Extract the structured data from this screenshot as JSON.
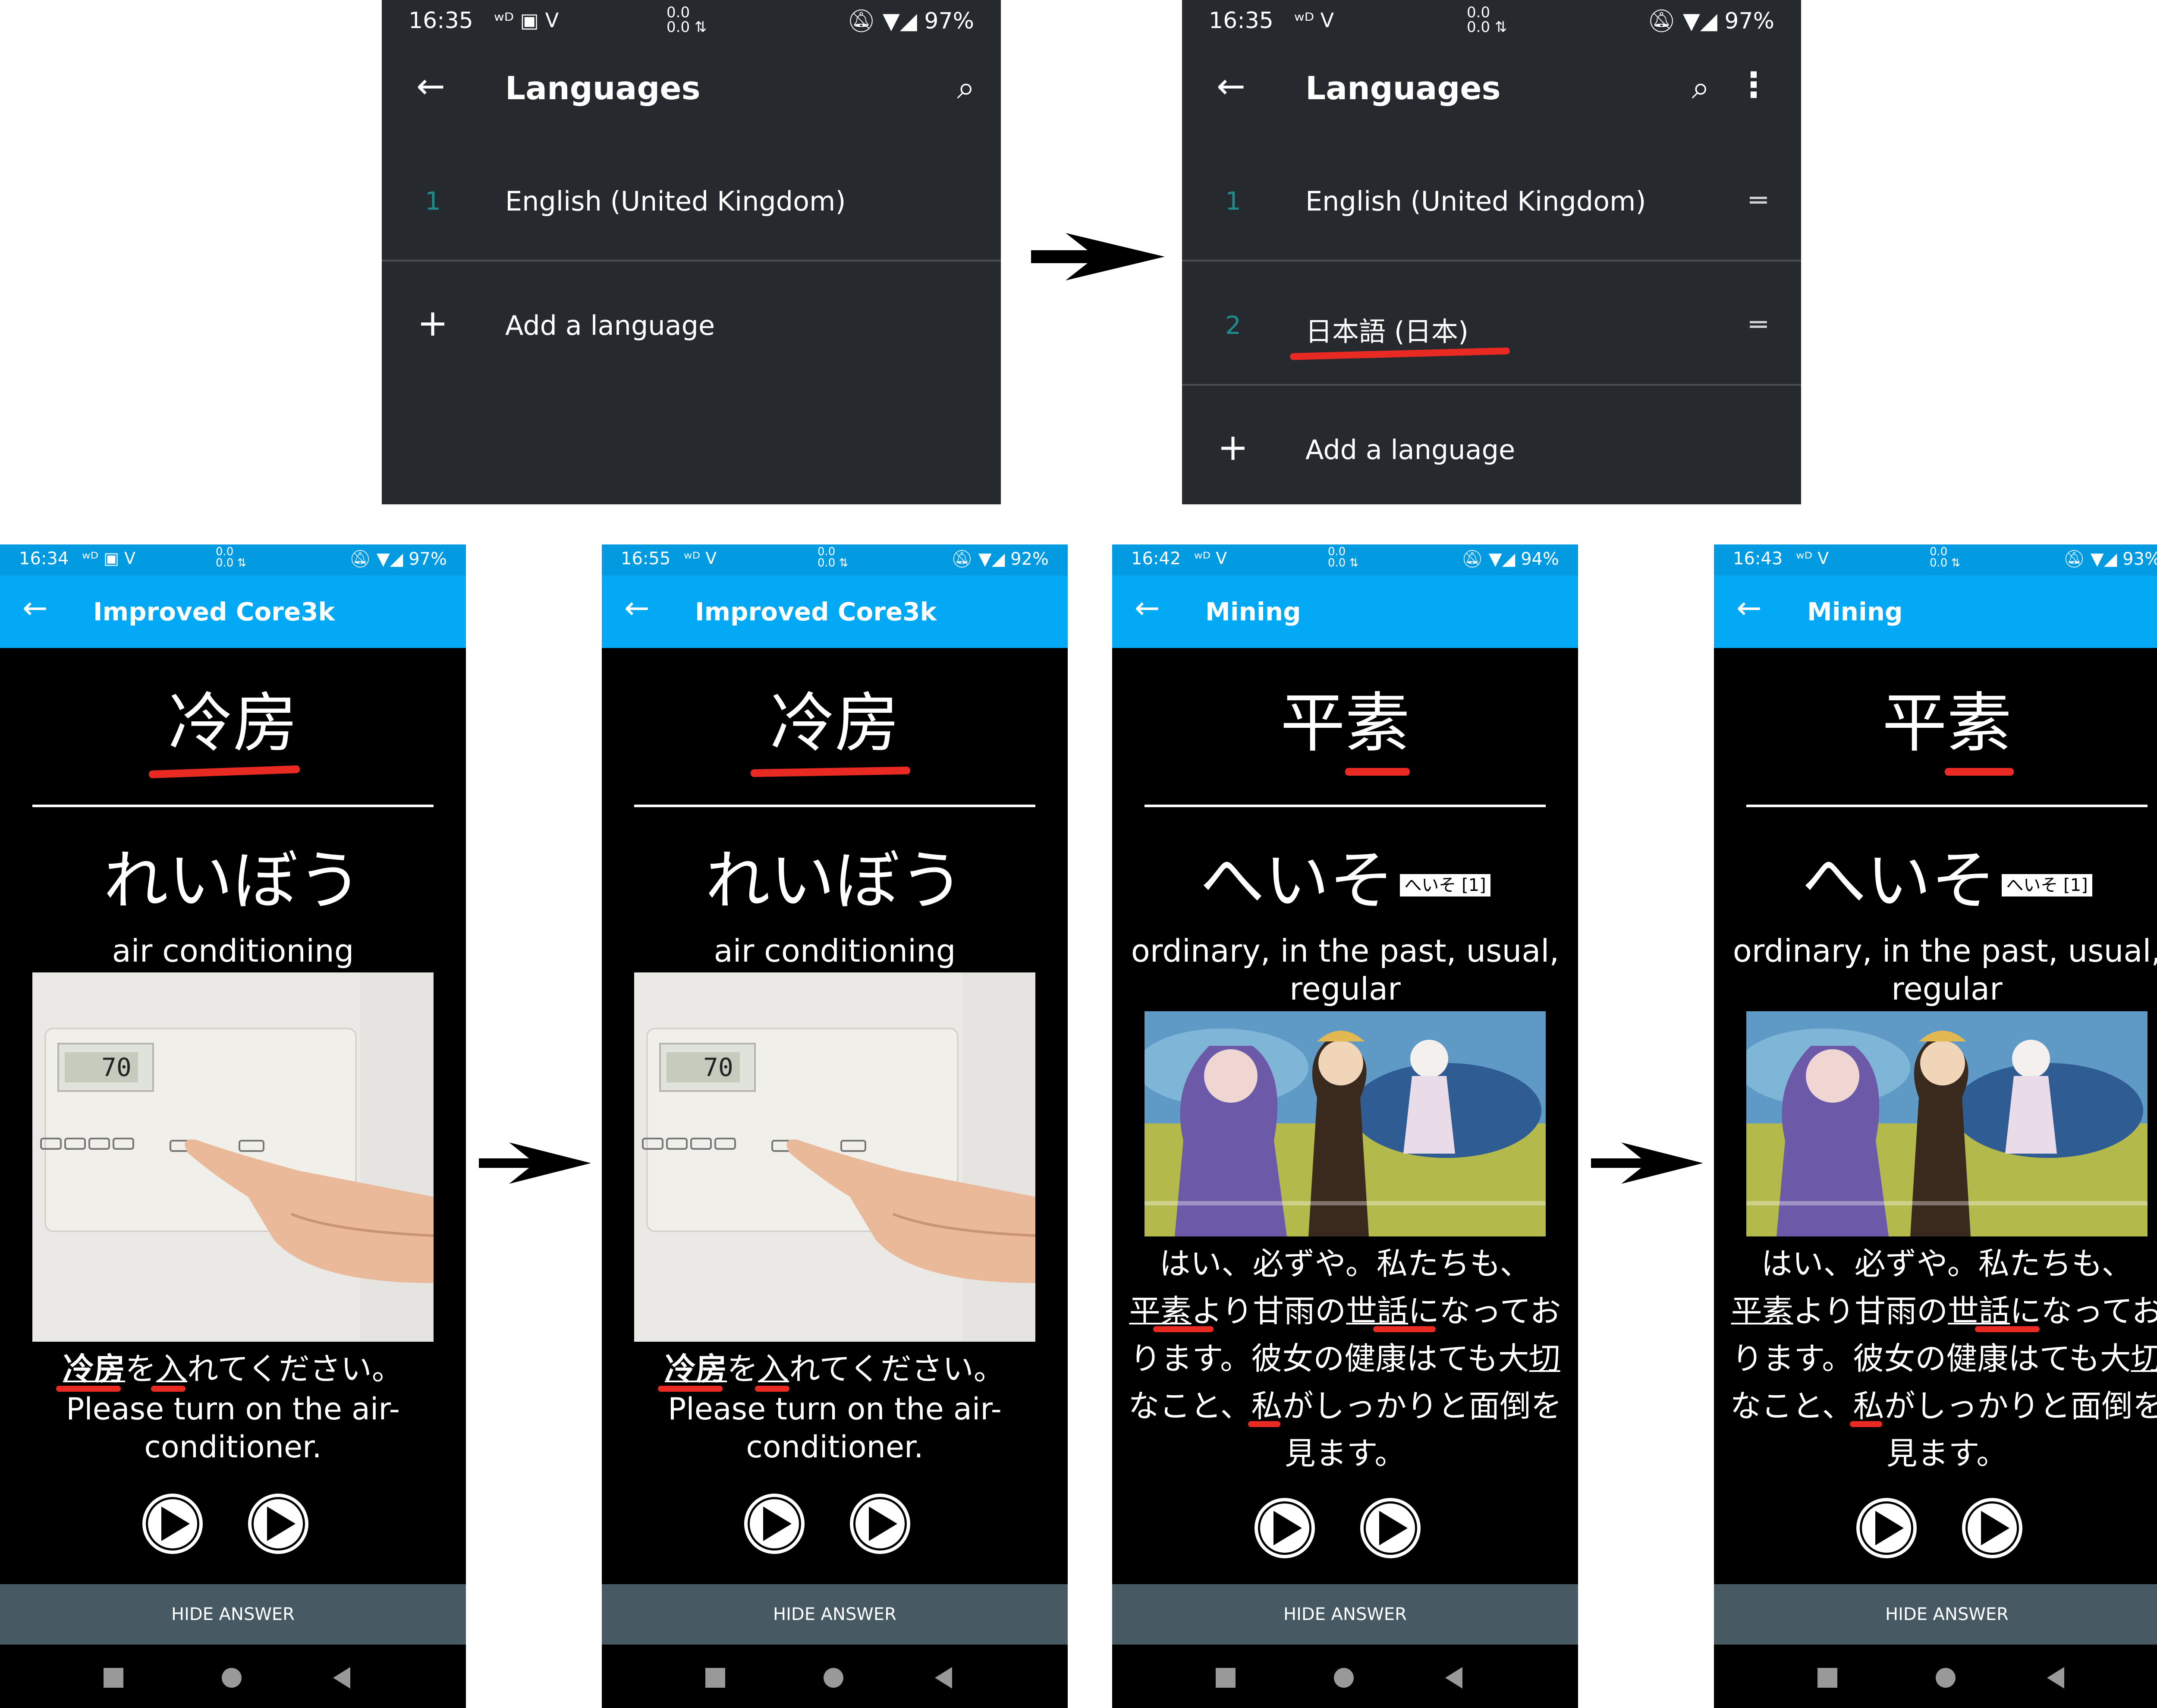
{
  "settings_before": {
    "status": {
      "time": "16:35",
      "mid_top": "0.0",
      "mid_bottom": "0.0",
      "battery": "97%"
    },
    "title": "Languages",
    "rows": [
      {
        "num": "1",
        "label": "English (United Kingdom)"
      }
    ],
    "add_label": "Add a language"
  },
  "settings_after": {
    "status": {
      "time": "16:35",
      "mid_top": "0.0",
      "mid_bottom": "0.0",
      "battery": "97%"
    },
    "title": "Languages",
    "rows": [
      {
        "num": "1",
        "label": "English (United Kingdom)"
      },
      {
        "num": "2",
        "label": "日本語 (日本)"
      }
    ],
    "add_label": "Add a language"
  },
  "cards": [
    {
      "status": {
        "time": "16:34",
        "mid_top": "0.0",
        "mid_bottom": "0.0",
        "battery": "97%"
      },
      "title": "Improved Core3k",
      "front": "冷房",
      "reading": "れいぼう",
      "meaning": "air conditioning",
      "sentence_parts": [
        "冷房",
        "を",
        "入",
        "れてください。"
      ],
      "translation": "Please turn on the air-conditioner.",
      "hide": "HIDE ANSWER"
    },
    {
      "status": {
        "time": "16:55",
        "mid_top": "0.0",
        "mid_bottom": "0.0",
        "battery": "92%"
      },
      "title": "Improved Core3k",
      "front": "冷房",
      "reading": "れいぼう",
      "meaning": "air conditioning",
      "sentence_parts": [
        "冷房",
        "を",
        "入",
        "れてください。"
      ],
      "translation": "Please turn on the air-conditioner.",
      "hide": "HIDE ANSWER"
    },
    {
      "status": {
        "time": "16:42",
        "mid_top": "0.0",
        "mid_bottom": "0.0",
        "battery": "94%"
      },
      "title": "Mining",
      "front": "平素",
      "reading": "へいそ",
      "pitch": "へいそ [1]",
      "meaning": "ordinary, in the past, usual, regular",
      "sentence_line1": "はい、必ずや。私たちも、",
      "sentence_parts": [
        "平素",
        "より甘雨の",
        "世話",
        "になっております。彼女の健康はても大",
        "切",
        "なこと、私がしっかりと面倒を見ます。"
      ],
      "hide": "HIDE ANSWER"
    },
    {
      "status": {
        "time": "16:43",
        "mid_top": "0.0",
        "mid_bottom": "0.0",
        "battery": "93%"
      },
      "title": "Mining",
      "front": "平素",
      "reading": "へいそ",
      "pitch": "へいそ [1]",
      "meaning": "ordinary, in the past, usual, regular",
      "sentence_line1": "はい、必ずや。私たちも、",
      "sentence_parts": [
        "平素",
        "より甘雨の",
        "世話",
        "になっております。彼女の健康はても大",
        "切",
        "なこと、私がしっかりと面倒を見ます。"
      ],
      "hide": "HIDE ANSWER"
    }
  ],
  "colors": {
    "settings_bg": "#26292d",
    "appbar": "#03a9f4",
    "statusbar": "#029ae0",
    "accent_red": "#e82a22",
    "hide_bar": "#475a64"
  }
}
